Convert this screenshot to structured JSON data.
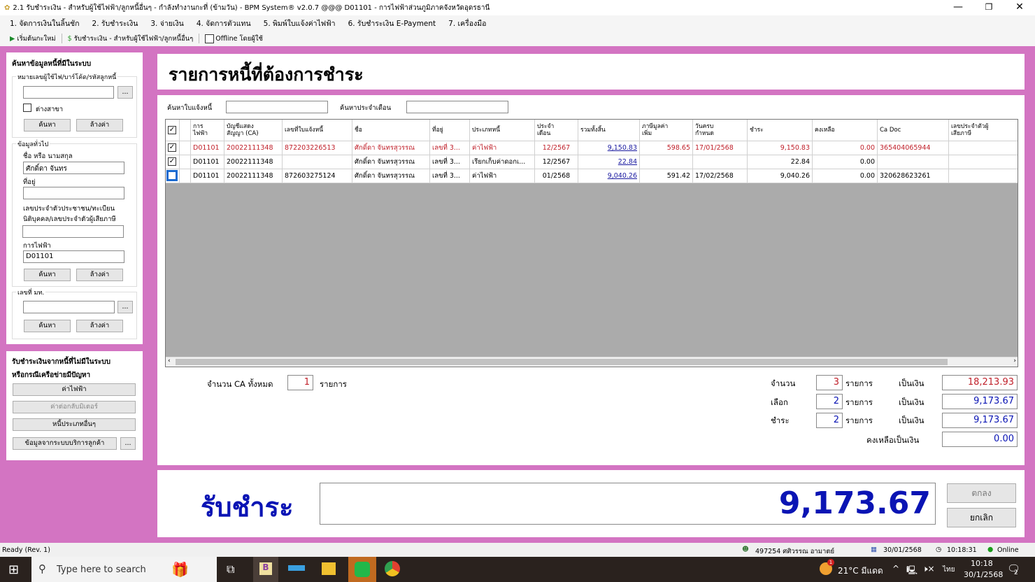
{
  "window": {
    "title": "2.1 รับชำระเงิน - สำหรับผู้ใช้ไฟฟ้า/ลูกหนี้อื่นๆ - กำลังทำงานกะที่ (ข้ามวัน) - BPM System® v2.0.7 @@@ D01101 - การไฟฟ้าส่วนภูมิภาคจังหวัดอุดรธานี",
    "controls": [
      "—",
      "❐",
      "✕"
    ]
  },
  "menu": [
    "1. จัดการเงินในลิ้นชัก",
    "2. รับชำระเงิน",
    "3. จ่ายเงิน",
    "4. จัดการตัวแทน",
    "5. พิมพ์ใบแจ้งค่าไฟฟ้า",
    "6. รับชำระเงิน E-Payment",
    "7. เครื่องมือ"
  ],
  "toolbar": {
    "restart": "เริ่มต้นกะใหม่",
    "receive": "รับชำระเงิน - สำหรับผู้ใช้ไฟฟ้า/ลูกหนี้อื่นๆ",
    "offline": "Offline โดยผู้ใช้",
    "offline_checked": false
  },
  "search": {
    "title": "ค้นหาข้อมูลหนี้ที่มีในระบบ",
    "group1": "หมายเลขผู้ใช้ไฟ/บาร์โค้ด/รหัสลูกหนี้",
    "group1_value": "",
    "other_branch": "ต่างสาขา",
    "search_btn": "ค้นหา",
    "clear_btn": "ล้างค่า",
    "browse": "...",
    "group2": "ข้อมูลทั่วไป",
    "name_label": "ชื่อ หรือ นามสกุล",
    "name_value": "ศักดิ์ดา จันทร",
    "address_label": "ที่อยู่",
    "address_value": "",
    "id_label1": "เลขประจำตัวประชาชน/ทะเบียน",
    "id_label2": "นิติบุคคล/เลขประจำตัวผู้เสียภาษี",
    "id_value": "",
    "pea_label": "การไฟฟ้า",
    "pea_value": "D01101",
    "group3": "เลขที่ มท.",
    "group3_value": ""
  },
  "offline_panel": {
    "title1": "รับชำระเงินจากหนี้ที่ไม่มีในระบบ",
    "title2": "หรือกรณีเครือข่ายมีปัญหา",
    "buttons": [
      "ค่าไฟฟ้า",
      "ค่าต่อกลับมิเตอร์",
      "หนี้ประเภทอื่นๆ",
      "ข้อมูลจากระบบบริการลูกค้า"
    ],
    "more": "..."
  },
  "main": {
    "title": "รายการหนี้ที่ต้องการชำระ",
    "invoice_search_label": "ค้นหาใบแจ้งหนี้",
    "invoice_search_value": "",
    "month_search_label": "ค้นหาประจำเดือน",
    "month_search_value": ""
  },
  "table": {
    "headers": [
      "",
      "",
      "การ\nไฟฟ้า",
      "บัญชีแสดง\nสัญญา (CA)",
      "เลขที่ใบแจ้งหนี้",
      "ชื่อ",
      "ที่อยู่",
      "ประเภทหนี้",
      "ประจำ\nเดือน",
      "รวมทั้งสิ้น",
      "ภาษีมูลค่า\nเพิ่ม",
      "วันครบ\nกำหนด",
      "ชำระ",
      "คงเหลือ",
      "Ca Doc",
      "เลขประจำตัวผู้\nเสียภาษี"
    ],
    "header_checked": true,
    "rows": [
      {
        "checked": true,
        "highlight": true,
        "cells": [
          "D01101",
          "20022111348",
          "872203226513",
          "ศักดิ์ดา  จันทรสุวรรณ",
          "เลขที่ 3...",
          "ค่าไฟฟ้า",
          "12/2567",
          "9,150.83",
          "598.65",
          "17/01/2568",
          "9,150.83",
          "0.00",
          "365404065944",
          ""
        ]
      },
      {
        "checked": true,
        "highlight": false,
        "cells": [
          "D01101",
          "20022111348",
          "",
          "ศักดิ์ดา  จันทรสุวรรณ",
          "เลขที่ 3...",
          "เรียกเก็บค่าดอกเ...",
          "12/2567",
          "22.84",
          "",
          "",
          "22.84",
          "0.00",
          "",
          ""
        ]
      },
      {
        "checked": false,
        "highlight": false,
        "cells": [
          "D01101",
          "20022111348",
          "872603275124",
          "ศักดิ์ดา  จันทรสุวรรณ",
          "เลขที่ 3...",
          "ค่าไฟฟ้า",
          "01/2568",
          "9,040.26",
          "591.42",
          "17/02/2568",
          "9,040.26",
          "0.00",
          "320628623261",
          ""
        ]
      }
    ]
  },
  "summary": {
    "ca_total_label": "จำนวน CA ทั้งหมด",
    "ca_total": "1",
    "unit": "รายการ",
    "amount_label": "เป็นเงิน",
    "count_label": "จำนวน",
    "count": "3",
    "count_amount": "18,213.93",
    "selected_label": "เลือก",
    "selected": "2",
    "selected_amount": "9,173.67",
    "pay_label": "ชำระ",
    "pay": "2",
    "pay_amount": "9,173.67",
    "remain_label": "คงเหลือเป็นเงิน",
    "remain_amount": "0.00"
  },
  "payment": {
    "label": "รับชำระ",
    "amount": "9,173.67",
    "ok": "ตกลง",
    "cancel": "ยกเลิก"
  },
  "status": {
    "ready": "Ready (Rev. 1)",
    "user": "497254 ศศิวรรณ อามาตย์",
    "date": "30/01/2568",
    "time": "10:18:31",
    "online": "Online"
  },
  "taskbar": {
    "search_placeholder": "Type here to search",
    "weather": "21°C  มีแดด",
    "lang": "ไทย",
    "time": "10:18",
    "date": "30/1/2568",
    "notifications": "2",
    "weather_badge": "1"
  },
  "colors": {
    "background": "#d374c2",
    "highlight_row": "#c0202a",
    "amount": "#0a14b4"
  }
}
